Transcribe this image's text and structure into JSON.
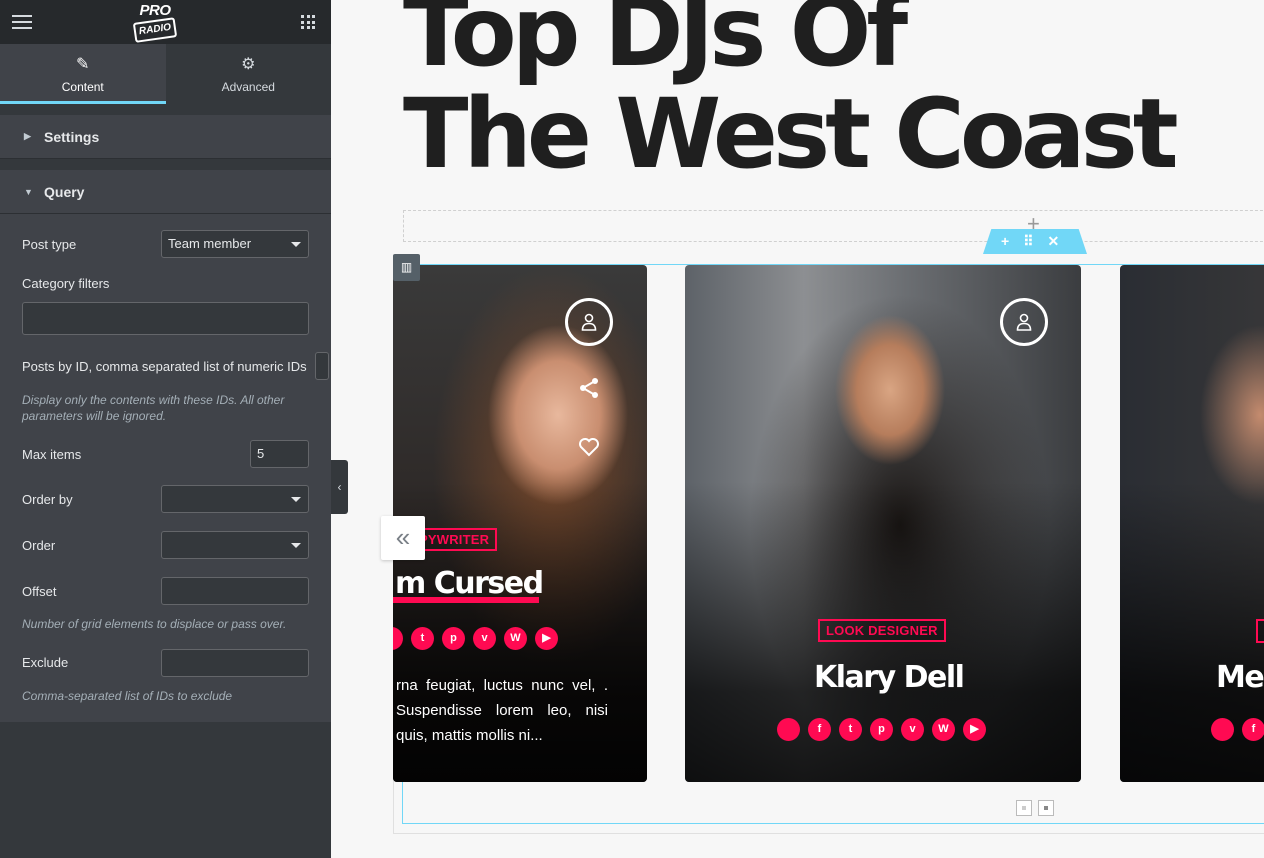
{
  "app": {
    "logo_line1": "PRO",
    "logo_line2": "RADIO"
  },
  "tabs": [
    {
      "label": "Content",
      "icon": "pencil-icon",
      "active": true
    },
    {
      "label": "Advanced",
      "icon": "gear-icon",
      "active": false
    }
  ],
  "sections": {
    "settings": {
      "label": "Settings",
      "expanded": false
    },
    "query": {
      "label": "Query",
      "expanded": true
    }
  },
  "query": {
    "post_type": {
      "label": "Post type",
      "value": "Team member"
    },
    "category_filters": {
      "label": "Category filters",
      "value": ""
    },
    "posts_by_id": {
      "label": "Posts by ID, comma separated list of numeric IDs",
      "description": "Display only the contents with these IDs. All other parameters will be ignored."
    },
    "max_items": {
      "label": "Max items",
      "value": "5"
    },
    "order_by": {
      "label": "Order by",
      "value": ""
    },
    "order": {
      "label": "Order",
      "value": ""
    },
    "offset": {
      "label": "Offset",
      "value": "",
      "description": "Number of grid elements to displace or pass over."
    },
    "exclude": {
      "label": "Exclude",
      "value": "",
      "description": "Comma-separated list of IDs to exclude"
    }
  },
  "page": {
    "heading_line1": "Top DJs Of",
    "heading_line2": "The West Coast"
  },
  "toolbar": {
    "add": "+",
    "move": "⠿",
    "close": "✕"
  },
  "cards": [
    {
      "role": "PYWRITER",
      "name": "m Cursed",
      "social": [
        "",
        "t",
        "p",
        "v",
        "W",
        "▶"
      ],
      "bio": "rna feugiat, luctus nunc vel, . Suspendisse lorem leo, nisi quis, mattis mollis ni..."
    },
    {
      "role": "LOOK DESIGNER",
      "name": "Klary Dell",
      "social": [
        "",
        "f",
        "t",
        "p",
        "v",
        "W",
        "▶"
      ]
    },
    {
      "role": "",
      "name": "Mel",
      "social": [
        "",
        "f"
      ]
    }
  ],
  "colors": {
    "accent": "#ff0a52",
    "editor_blue": "#71d7f7",
    "panel": "#404349",
    "panel_dark": "#34383c"
  }
}
